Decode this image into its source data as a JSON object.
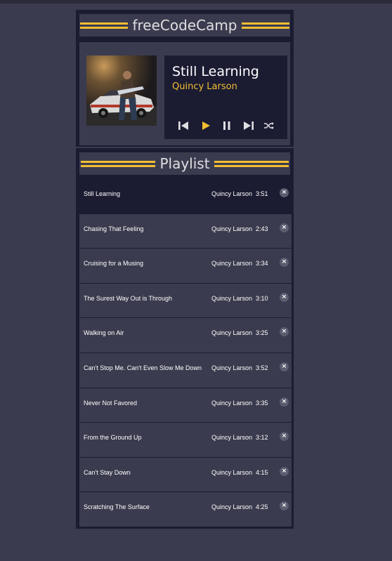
{
  "colors": {
    "background": "#3b3b4f",
    "panel": "#1b1b32",
    "accent": "#f1be32",
    "text": "#ffffff"
  },
  "player": {
    "brand": "freeCodeCamp",
    "current_song": {
      "title": "Still Learning",
      "artist": "Quincy Larson"
    },
    "controls": [
      {
        "name": "previous",
        "icon": "previous-icon"
      },
      {
        "name": "play",
        "icon": "play-icon"
      },
      {
        "name": "pause",
        "icon": "pause-icon"
      },
      {
        "name": "next",
        "icon": "next-icon"
      },
      {
        "name": "shuffle",
        "icon": "shuffle-icon"
      }
    ]
  },
  "playlist": {
    "heading": "Playlist",
    "songs": [
      {
        "title": "Still Learning",
        "artist": "Quincy Larson",
        "duration": "3:51",
        "current": true
      },
      {
        "title": "Chasing That Feeling",
        "artist": "Quincy Larson",
        "duration": "2:43"
      },
      {
        "title": "Cruising for a Musing",
        "artist": "Quincy Larson",
        "duration": "3:34"
      },
      {
        "title": "The Surest Way Out is Through",
        "artist": "Quincy Larson",
        "duration": "3:10"
      },
      {
        "title": "Walking on Air",
        "artist": "Quincy Larson",
        "duration": "3:25"
      },
      {
        "title": "Can't Stop Me. Can't Even Slow Me Down",
        "artist": "Quincy Larson",
        "duration": "3:52"
      },
      {
        "title": "Never Not Favored",
        "artist": "Quincy Larson",
        "duration": "3:35"
      },
      {
        "title": "From the Ground Up",
        "artist": "Quincy Larson",
        "duration": "3:12"
      },
      {
        "title": "Can't Stay Down",
        "artist": "Quincy Larson",
        "duration": "4:15"
      },
      {
        "title": "Scratching The Surface",
        "artist": "Quincy Larson",
        "duration": "4:25"
      }
    ],
    "delete_icon": "close-icon",
    "delete_glyph": "×"
  }
}
